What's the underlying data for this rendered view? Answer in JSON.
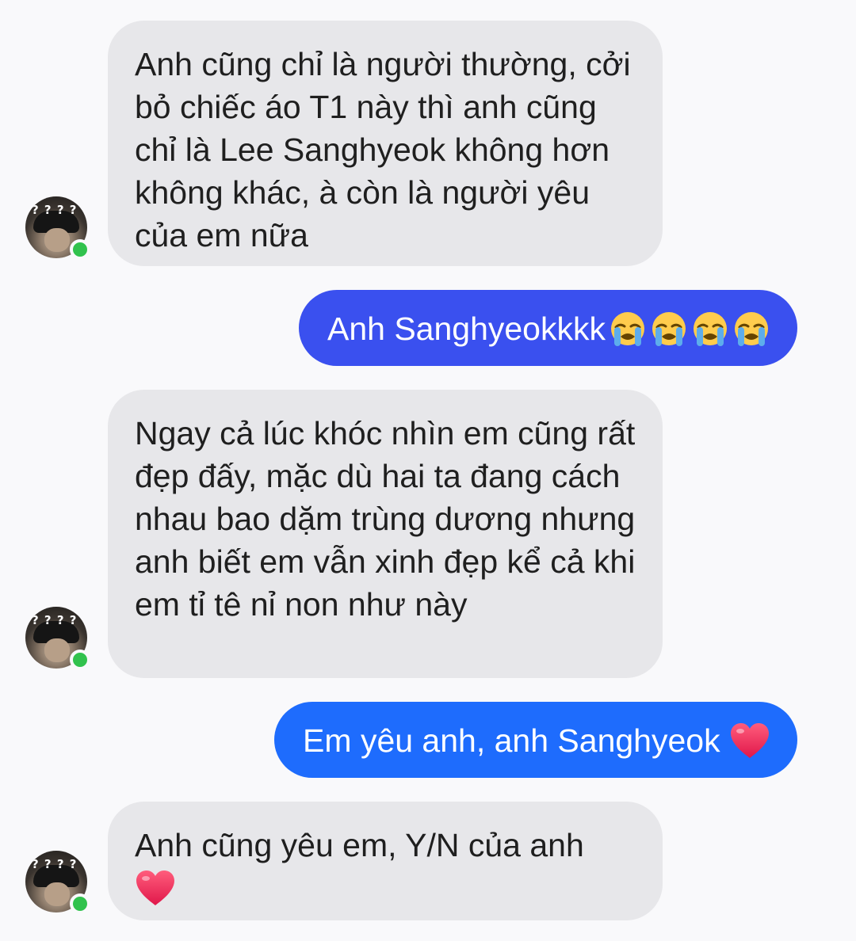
{
  "colors": {
    "background": "#f9f9fb",
    "incoming_bubble": "#e7e7ea",
    "outgoing_gradient_top": "#3b56f1",
    "outgoing_gradient_bottom": "#1a72ff",
    "online": "#31c24d"
  },
  "avatar": {
    "overlay_text": "? ? ? ?"
  },
  "messages": [
    {
      "direction": "incoming",
      "text": "Anh cũng chỉ là người thường, cởi bỏ chiếc áo T1 này thì anh cũng chỉ là Lee Sanghyeok không hơn không khác, à còn là người yêu của em nữa"
    },
    {
      "direction": "outgoing",
      "text": "Anh Sanghyeokkkk",
      "emoji": [
        "loudly-crying-face",
        "loudly-crying-face",
        "loudly-crying-face",
        "loudly-crying-face"
      ]
    },
    {
      "direction": "incoming",
      "text": "Ngay cả lúc khóc nhìn em cũng rất đẹp đấy, mặc dù hai ta đang cách nhau bao dặm trùng dương nhưng anh biết em vẫn xinh đẹp kể cả khi em tỉ tê nỉ non như này"
    },
    {
      "direction": "outgoing",
      "text": "Em yêu anh, anh Sanghyeok",
      "emoji": [
        "red-heart"
      ]
    },
    {
      "direction": "incoming",
      "text": "Anh cũng yêu em, Y/N của anh",
      "emoji": [
        "red-heart"
      ]
    }
  ]
}
